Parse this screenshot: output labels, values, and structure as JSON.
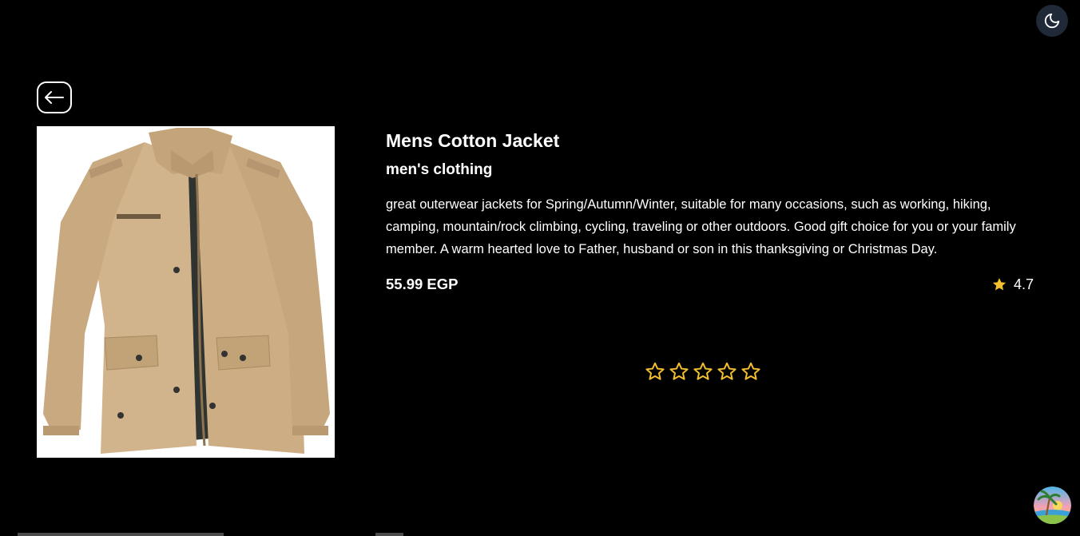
{
  "theme_toggle": {
    "icon": "moon-icon"
  },
  "back_button": {
    "icon": "arrow-left-icon"
  },
  "product": {
    "image_alt": "Mens Cotton Jacket",
    "title": "Mens Cotton Jacket",
    "category": "men's clothing",
    "description": "great outerwear jackets for Spring/Autumn/Winter, suitable for many occasions, such as working, hiking, camping, mountain/rock climbing, cycling, traveling or other outdoors. Good gift choice for you or your family member. A warm hearted love to Father, husband or son in this thanksgiving or Christmas Day.",
    "price": "55.99 EGP",
    "rating": "4.7"
  },
  "rate_stars": {
    "count": 5,
    "selected": 0,
    "icon": "star-outline-icon"
  },
  "colors": {
    "background": "#000000",
    "text": "#ffffff",
    "star": "#f5c02c",
    "toggle_bg": "#1f2937"
  },
  "fab": {
    "icon": "beach-palm-icon"
  }
}
